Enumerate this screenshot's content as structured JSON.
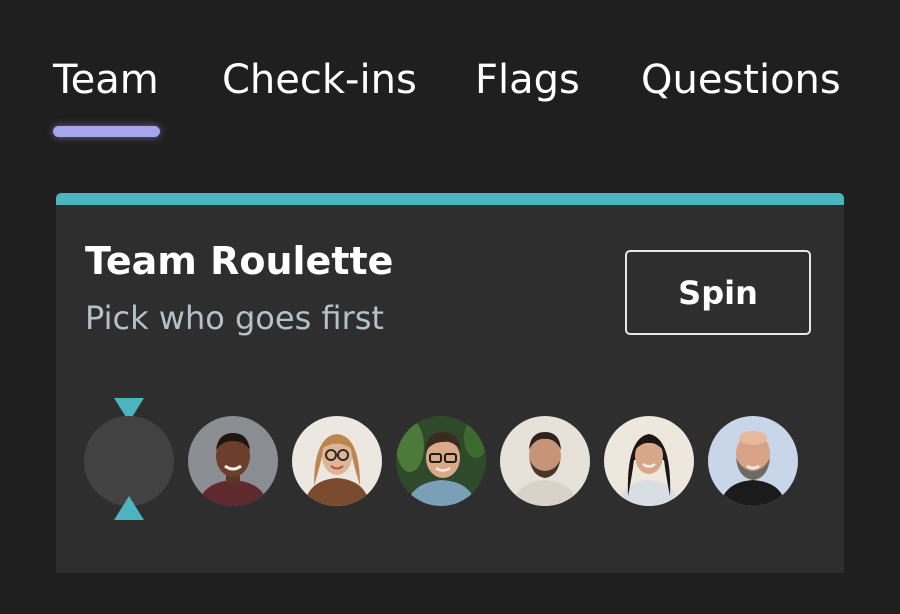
{
  "tabs": [
    {
      "label": "Team",
      "selected": true
    },
    {
      "label": "Check-ins",
      "selected": false
    },
    {
      "label": "Flags",
      "selected": false
    },
    {
      "label": "Questions",
      "selected": false
    }
  ],
  "card": {
    "title": "Team Roulette",
    "subtitle": "Pick who goes first",
    "spin_label": "Spin",
    "accent_color": "#4cb3bf"
  },
  "colors": {
    "tab_indicator": "#a6a6ee",
    "background": "#1f1f1f",
    "card_background": "#2e2e2e"
  },
  "team_members": [
    {
      "icon": "avatar-man-short-hair"
    },
    {
      "icon": "avatar-woman-glasses"
    },
    {
      "icon": "avatar-man-glasses"
    },
    {
      "icon": "avatar-man-beard"
    },
    {
      "icon": "avatar-woman-long-hair"
    },
    {
      "icon": "avatar-man-bald-beard"
    }
  ]
}
